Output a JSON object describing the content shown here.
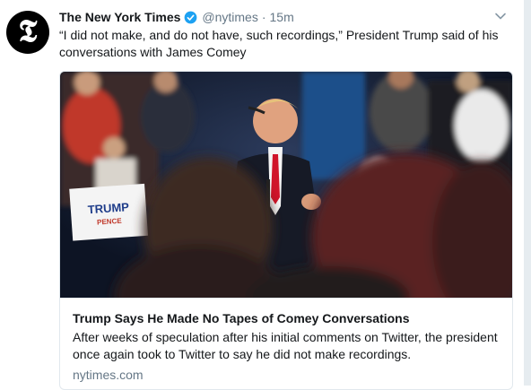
{
  "tweet": {
    "author_name": "The New York Times",
    "handle": "@nytimes",
    "separator": "·",
    "time": "15m",
    "avatar_glyph": "𝕿",
    "text": "“I did not make, and do not have, such recordings,” President Trump said of his conversations with James Comey",
    "verified_icon": "verified-badge-icon",
    "menu_icon": "chevron-down-icon"
  },
  "card": {
    "sign_line1": "TRUMP",
    "sign_line2": "PENCE",
    "title": "Trump Says He Made No Tapes of Comey Conversations",
    "description": "After weeks of speculation after his initial comments on Twitter, the president once again took to Twitter to say he did not make recordings.",
    "domain": "nytimes.com"
  },
  "colors": {
    "verified_blue": "#1da1f2",
    "secondary_text": "#657786",
    "border": "#e1e8ed"
  }
}
